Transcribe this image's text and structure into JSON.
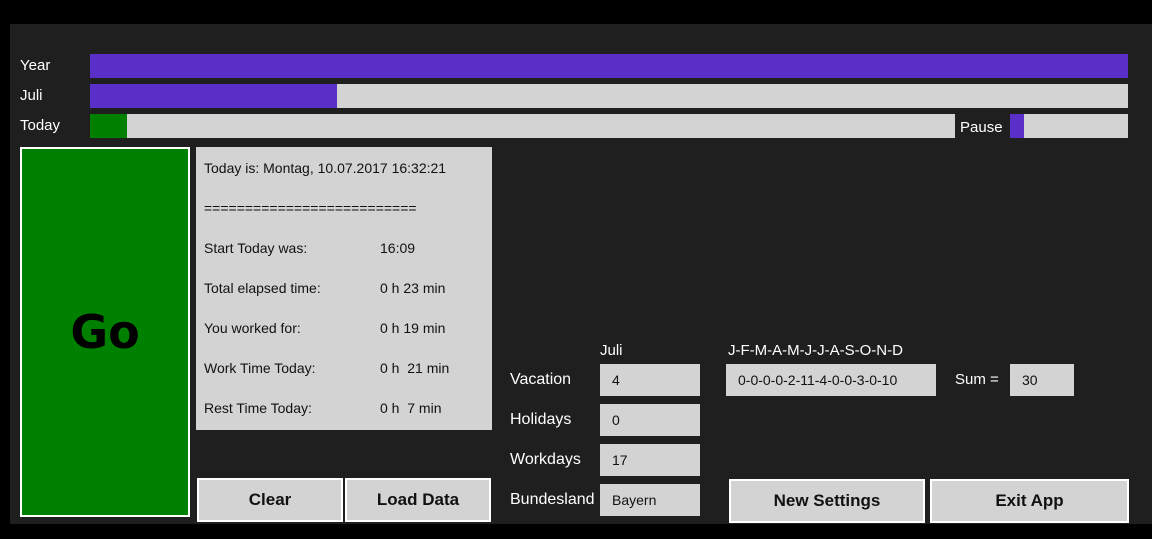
{
  "progress": {
    "year": {
      "label": "Year",
      "fraction": 1.0
    },
    "month": {
      "label": "Juli",
      "fraction": 0.238
    },
    "today": {
      "label": "Today",
      "fraction": 0.043
    },
    "pause": {
      "label": "Pause",
      "fraction": 0.12
    }
  },
  "go_button": {
    "label": "Go"
  },
  "info": {
    "today_is": "Today is: Montag, 10.07.2017 16:32:21",
    "separator": "==========================",
    "rows": [
      {
        "label": "Start Today was:",
        "value": "16:09"
      },
      {
        "label": "Total elapsed time:",
        "value": "0 h 23 min"
      },
      {
        "label": "You worked for:",
        "value": "0 h 19 min"
      },
      {
        "label": "Work Time Today:",
        "value": "0 h  21 min"
      },
      {
        "label": "Rest Time Today:",
        "value": "0 h  7 min"
      }
    ]
  },
  "buttons": {
    "clear": "Clear",
    "load_data": "Load Data",
    "new_settings": "New Settings",
    "exit_app": "Exit App"
  },
  "settings": {
    "month_header": "Juli",
    "months_header": "J-F-M-A-M-J-J-A-S-O-N-D",
    "vacation": {
      "label": "Vacation",
      "value": "4"
    },
    "holidays": {
      "label": "Holidays",
      "value": "0"
    },
    "workdays": {
      "label": "Workdays",
      "value": "17"
    },
    "bundesland": {
      "label": "Bundesland",
      "value": "Bayern"
    },
    "vacation_by_month": "0-0-0-0-2-11-4-0-0-3-0-10",
    "sum_label": "Sum =",
    "sum_value": "30"
  },
  "colors": {
    "progress_purple": "#5a2fc8",
    "today_green": "#008000",
    "track_gray": "#d3d3d3",
    "background": "#1f1f1f"
  }
}
